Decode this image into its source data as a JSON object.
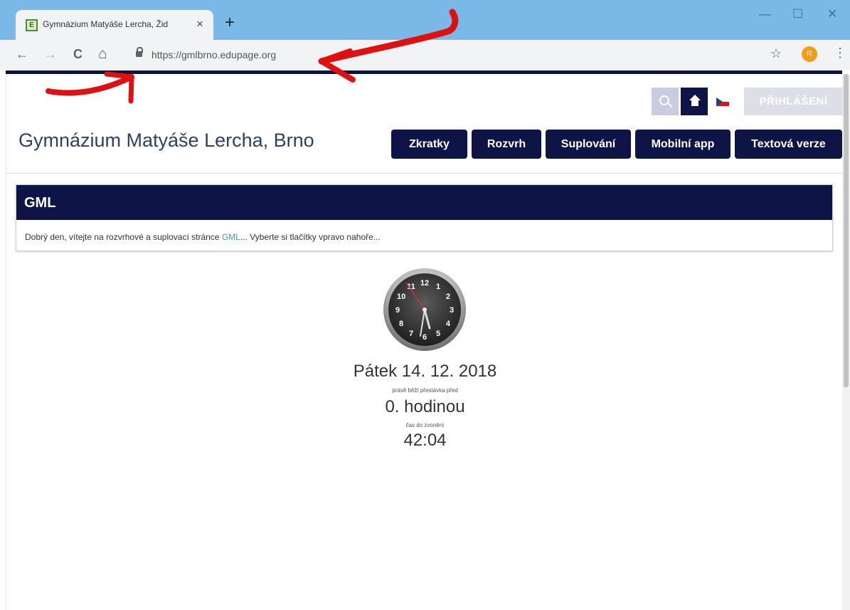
{
  "browser": {
    "tab_title": "Gymnázium Matyáše Lercha, Žid",
    "tab_favicon": "E",
    "tab_close": "×",
    "new_tab": "+",
    "window_controls": {
      "minimize": "—",
      "maximize": "☐",
      "close": "✕"
    },
    "nav": {
      "back": "←",
      "forward": "→",
      "reload": "C",
      "home": "⌂"
    },
    "url": "https://gmlbrno.edupage.org",
    "bookmark_star": "☆",
    "profile_initial": "R",
    "menu": "⋮"
  },
  "site": {
    "login_label": "PŘIHLÁŠENÍ",
    "title": "Gymnázium Matyáše Lercha, Brno",
    "menu": [
      "Zkratky",
      "Rozvrh",
      "Suplování",
      "Mobilní app",
      "Textová verze"
    ]
  },
  "panel": {
    "title": "GML",
    "text_before": "Dobrý den, vítejte na rozvrhové a suplovací stránce ",
    "link": "GML",
    "text_after": "... Vyberte si tlačítky vpravo nahoře..."
  },
  "clock": {
    "numbers": [
      "12",
      "1",
      "2",
      "3",
      "4",
      "5",
      "6",
      "7",
      "8",
      "9",
      "10",
      "11"
    ]
  },
  "status": {
    "date": "Pátek 14. 12. 2018",
    "break_label": "právě běží přestávka před",
    "lesson": "0. hodinou",
    "bell_label": "čas do zvonění",
    "countdown": "42:04"
  },
  "colors": {
    "navy": "#0f1446",
    "chrome_frame": "#7ab8e8",
    "annotation_red": "#e01010",
    "link": "#4b8ec4"
  },
  "icons": [
    "search-icon",
    "home-icon",
    "czech-flag-icon",
    "lock-icon",
    "star-icon"
  ]
}
